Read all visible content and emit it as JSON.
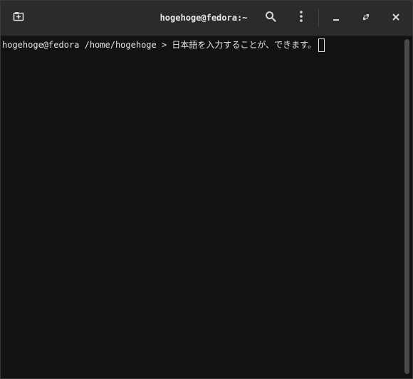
{
  "window": {
    "title": "hogehoge@fedora:~"
  },
  "toolbar": {
    "new_tab_icon": "new-tab-icon",
    "search_icon": "search-icon",
    "menu_icon": "kebab-menu-icon",
    "minimize_icon": "minimize-icon",
    "maximize_icon": "restore-icon",
    "close_icon": "close-icon"
  },
  "terminal": {
    "prompt": "hogehoge@fedora /home/hogehoge >",
    "input": "日本語を入力することが、できます。"
  },
  "colors": {
    "titlebar_bg": "#2b2b2b",
    "terminal_bg": "#121212",
    "text": "#e3e3e3"
  }
}
